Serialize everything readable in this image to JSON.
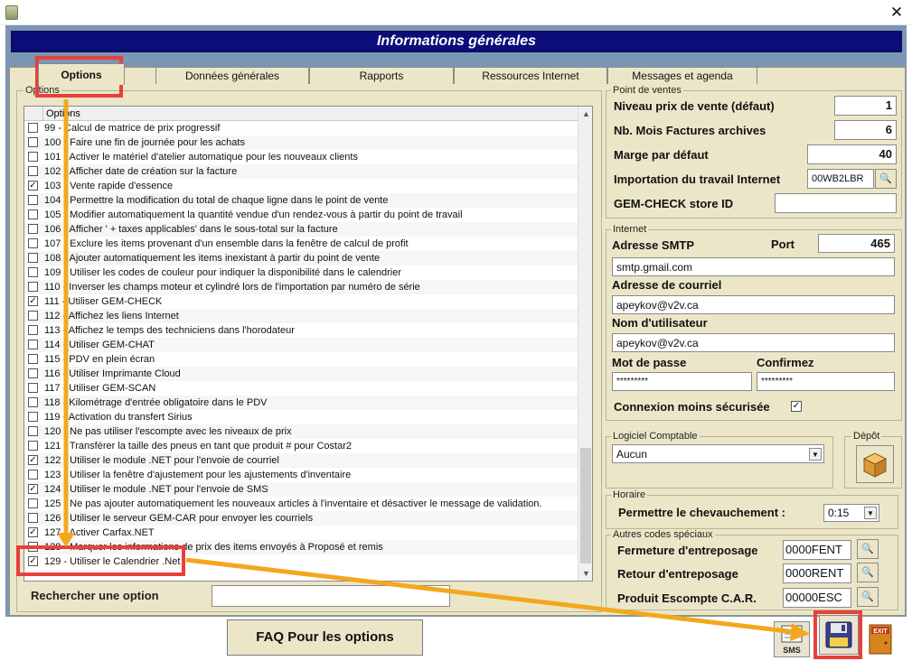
{
  "window": {
    "title": "Informations générales",
    "close_glyph": "✕",
    "app_icon": "app-icon"
  },
  "tabs": [
    {
      "label": "Options",
      "active": true
    },
    {
      "label": "Données générales",
      "active": false
    },
    {
      "label": "Rapports",
      "active": false
    },
    {
      "label": "Ressources Internet",
      "active": false
    },
    {
      "label": "Messages et agenda",
      "active": false
    }
  ],
  "options_panel": {
    "group_label": "Options",
    "column_header": "Options",
    "search_label": "Rechercher une option",
    "search_value": "",
    "items": [
      {
        "label": "99 - Calcul de matrice de prix progressif",
        "checked": false
      },
      {
        "label": "100 - Faire une fin de journée pour les achats",
        "checked": false
      },
      {
        "label": "101 - Activer le matériel d'atelier automatique pour les nouveaux clients",
        "checked": false
      },
      {
        "label": "102 - Afficher date de création sur la facture",
        "checked": false
      },
      {
        "label": "103 - Vente rapide d'essence",
        "checked": true
      },
      {
        "label": "104 - Permettre la modification du total de chaque ligne dans le point de vente",
        "checked": false
      },
      {
        "label": "105 - Modifier automatiquement la quantité vendue d'un rendez-vous à partir du point de travail",
        "checked": false
      },
      {
        "label": "106 - Afficher ' + taxes applicables' dans le sous-total sur la facture",
        "checked": false
      },
      {
        "label": "107 - Exclure les items provenant d'un ensemble dans la fenêtre de calcul de profit",
        "checked": false
      },
      {
        "label": "108 - Ajouter automatiquement les items inexistant à partir du point de vente",
        "checked": false
      },
      {
        "label": "109 - Utiliser les codes de couleur pour indiquer la disponibilité dans le calendrier",
        "checked": false
      },
      {
        "label": "110 - Inverser les champs moteur et cylindré lors de l'importation par numéro de série",
        "checked": false
      },
      {
        "label": "111 - Utiliser GEM-CHECK",
        "checked": true
      },
      {
        "label": "112 - Affichez les liens Internet",
        "checked": false
      },
      {
        "label": "113 - Affichez le temps des techniciens dans l'horodateur",
        "checked": false
      },
      {
        "label": "114 - Utiliser GEM-CHAT",
        "checked": false
      },
      {
        "label": "115 - PDV en plein écran",
        "checked": false
      },
      {
        "label": "116 - Utiliser Imprimante Cloud",
        "checked": false
      },
      {
        "label": "117 - Utiliser GEM-SCAN",
        "checked": false
      },
      {
        "label": "118 - Kilométrage d'entrée obligatoire dans le PDV",
        "checked": false
      },
      {
        "label": "119 - Activation du transfert Sirius",
        "checked": false
      },
      {
        "label": "120 - Ne pas utiliser l'escompte avec les niveaux de prix",
        "checked": false
      },
      {
        "label": "121 - Transférer la taille des pneus en tant que produit # pour Costar2",
        "checked": false
      },
      {
        "label": "122 - Utiliser le module .NET pour l'envoie de courriel",
        "checked": true
      },
      {
        "label": "123 - Utiliser la fenêtre d'ajustement pour les ajustements d'inventaire",
        "checked": false
      },
      {
        "label": "124 - Utiliser le module .NET pour l'envoie de SMS",
        "checked": true
      },
      {
        "label": "125 - Ne pas ajouter automatiquement les nouveaux articles à l'inventaire et désactiver le message de validation.",
        "checked": false
      },
      {
        "label": "126 - Utiliser le serveur GEM-CAR pour envoyer les courriels",
        "checked": false
      },
      {
        "label": "127 - Activer Carfax.NET",
        "checked": true
      },
      {
        "label": "128 - Marquer les informations de prix des items envoyés à Proposé et remis",
        "checked": false
      },
      {
        "label": "129 - Utiliser le Calendrier .Net",
        "checked": true
      }
    ]
  },
  "point_de_ventes": {
    "group_label": "Point de ventes",
    "niveau_prix_label": "Niveau prix de vente (défaut)",
    "niveau_prix_value": "1",
    "nb_mois_label": "Nb. Mois Factures archives",
    "nb_mois_value": "6",
    "marge_label": "Marge par défaut",
    "marge_value": "40",
    "import_label": "Importation du travail Internet",
    "import_value": "00WB2LBR",
    "gemcheck_label": "GEM-CHECK store ID",
    "gemcheck_value": ""
  },
  "internet": {
    "group_label": "Internet",
    "smtp_label": "Adresse SMTP",
    "port_label": "Port",
    "port_value": "465",
    "smtp_value": "smtp.gmail.com",
    "courriel_label": "Adresse de courriel",
    "courriel_value": "apeykov@v2v.ca",
    "user_label": "Nom d'utilisateur",
    "user_value": "apeykov@v2v.ca",
    "pass_label": "Mot de passe",
    "pass_value": "*********",
    "confirm_label": "Confirmez",
    "confirm_value": "*********",
    "insecure_label": "Connexion moins sécurisée",
    "insecure_checked": true
  },
  "logiciel": {
    "group_label": "Logiciel Comptable",
    "value": "Aucun"
  },
  "depot": {
    "group_label": "Dépôt"
  },
  "horaire": {
    "group_label": "Horaire",
    "label": "Permettre le chevauchement :",
    "value": "0:15"
  },
  "autres_codes": {
    "group_label": "Autres codes spéciaux",
    "rows": [
      {
        "label": "Fermeture d'entreposage",
        "value": "0000FENT"
      },
      {
        "label": "Retour d'entreposage",
        "value": "0000RENT"
      },
      {
        "label": "Produit Escompte C.A.R.",
        "value": "00000ESC"
      }
    ]
  },
  "footer": {
    "faq_label": "FAQ Pour les options",
    "sms_label": "SMS",
    "exit_label": "EXIT"
  },
  "colors": {
    "header_bg": "#0c0c7a",
    "panel_bg": "#ece6c8",
    "frame_bg": "#7a96b6",
    "annotation_red": "#e8403a",
    "annotation_orange": "#f2a81e"
  }
}
